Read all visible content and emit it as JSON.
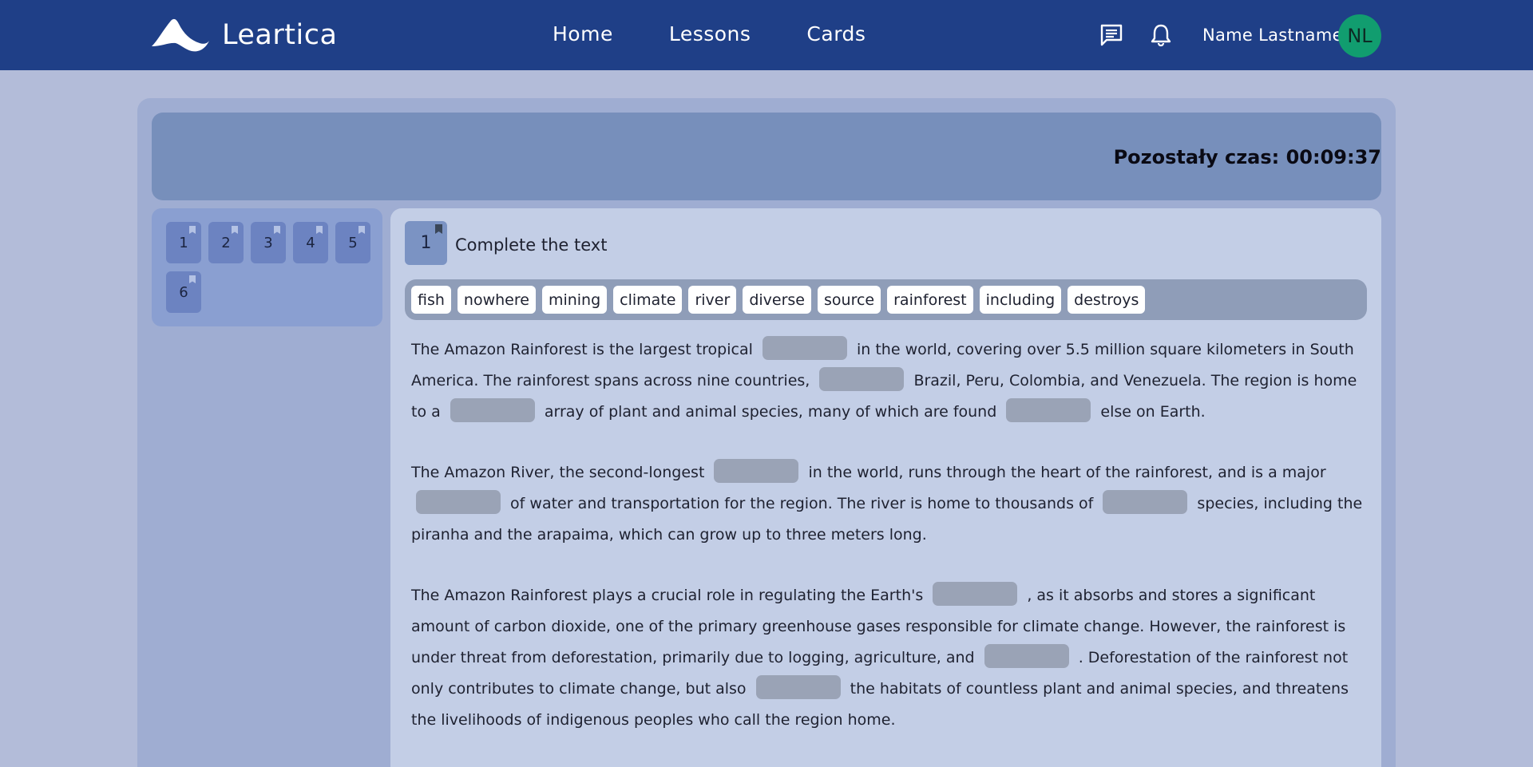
{
  "app": {
    "name": "Leartica"
  },
  "nav": {
    "home": "Home",
    "lessons": "Lessons",
    "cards": "Cards"
  },
  "user": {
    "name": "Name Lastname",
    "initials": "NL"
  },
  "icons": {
    "messages": "chat-icon",
    "notifications": "bell-icon"
  },
  "timer": {
    "text": "Pozostały czas: 00:09:37"
  },
  "questions": {
    "items": [
      "1",
      "2",
      "3",
      "4",
      "5",
      "6"
    ]
  },
  "current_question": {
    "number": "1",
    "title": "Complete the text"
  },
  "word_bank": [
    "fish",
    "nowhere",
    "mining",
    "climate",
    "river",
    "diverse",
    "source",
    "rainforest",
    "including",
    "destroys"
  ],
  "text": {
    "p1": {
      "s1": "The Amazon Rainforest is the largest tropical",
      "s2": "in the world, covering over 5.5 million square kilometers in South America. The rainforest spans across nine countries,",
      "s3": "Brazil, Peru, Colombia, and Venezuela. The region is home to a",
      "s4": "array of plant and animal species, many of which are found",
      "s5": "else on Earth."
    },
    "p2": {
      "s1": "The Amazon River, the second-longest",
      "s2": "in the world, runs through the heart of the rainforest, and is a major",
      "s3": "of water and transportation for the region. The river is home to thousands of",
      "s4": "species, including the piranha and the arapaima, which can grow up to three meters long."
    },
    "p3": {
      "s1": "The Amazon Rainforest plays a crucial role in regulating the Earth's",
      "s2": ", as it absorbs and stores a significant amount of carbon dioxide, one of the primary greenhouse gases responsible for climate change. However, the rainforest is under threat from deforestation, primarily due to logging, agriculture, and",
      "s3": ". Deforestation of the rainforest not only contributes to climate change, but also",
      "s4": "the habitats of countless plant and animal species, and threatens the livelihoods of indigenous peoples who call the region home."
    }
  },
  "colors": {
    "header": "#1f3f87",
    "avatar": "#119d6f",
    "background": "#b3bcd9",
    "blank": "#9aa3b6"
  }
}
